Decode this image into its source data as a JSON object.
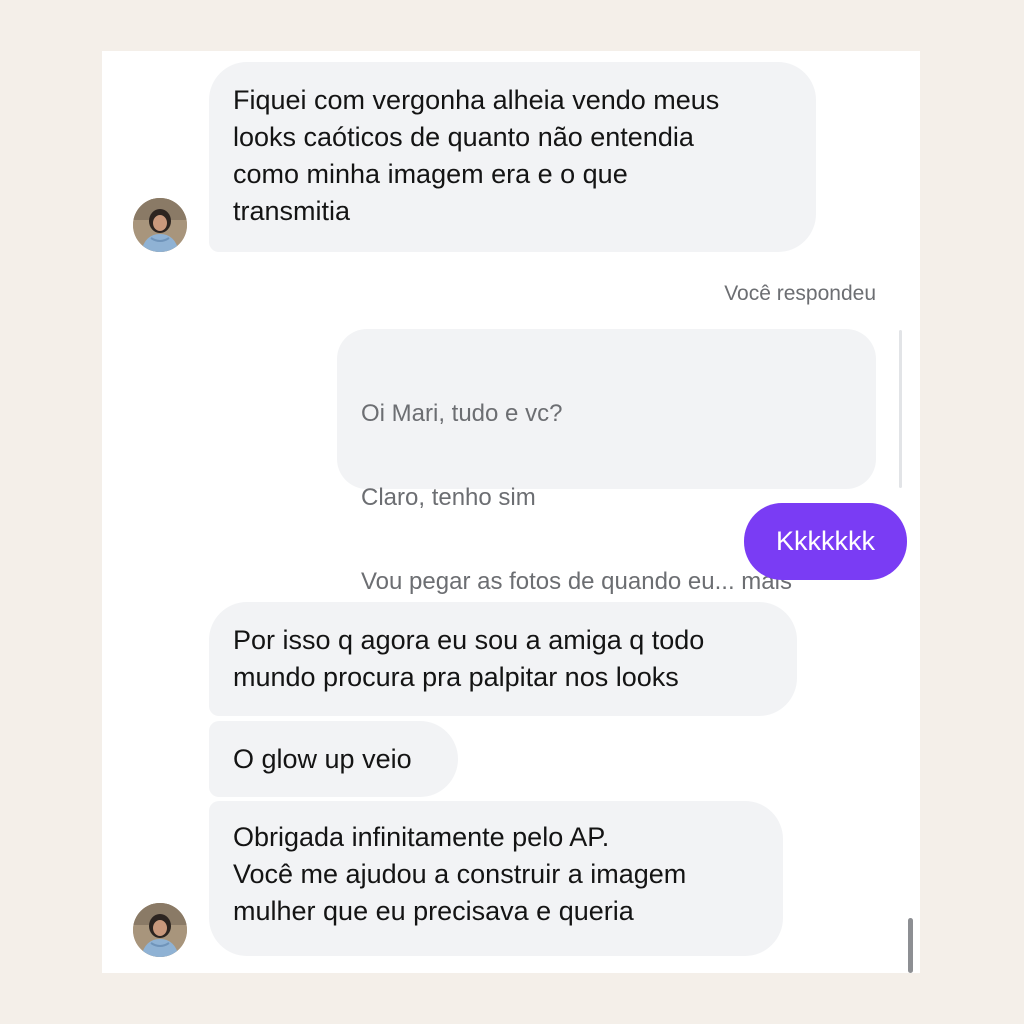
{
  "conversation": {
    "messages_in_1": "Fiquei com vergonha alheia vendo meus\nlooks caóticos de quanto não entendia\ncomo minha imagem era e o que\ntransmitia",
    "reply_label": "Você respondeu",
    "reply_quote": {
      "line1": "Oi Mari, tudo e vc?",
      "line2": "Claro, tenho sim",
      "line3": "Vou pegar as fotos de quando eu... mais"
    },
    "outgoing": "Kkkkkkk",
    "messages_in_2": "Por isso q agora eu sou a amiga q todo\nmundo procura pra palpitar nos looks",
    "messages_in_3": "O glow up veio",
    "messages_in_4": "Obrigada infinitamente pelo AP.\nVocê me ajudou a construir a imagem\nmulher que eu precisava e queria"
  },
  "colors": {
    "page_background": "#f4efe9",
    "incoming_bubble": "#f2f3f5",
    "outgoing_bubble": "#7a3cf4",
    "secondary_text": "#6c6e72"
  },
  "icons": {
    "avatar": "user-avatar-photo"
  }
}
